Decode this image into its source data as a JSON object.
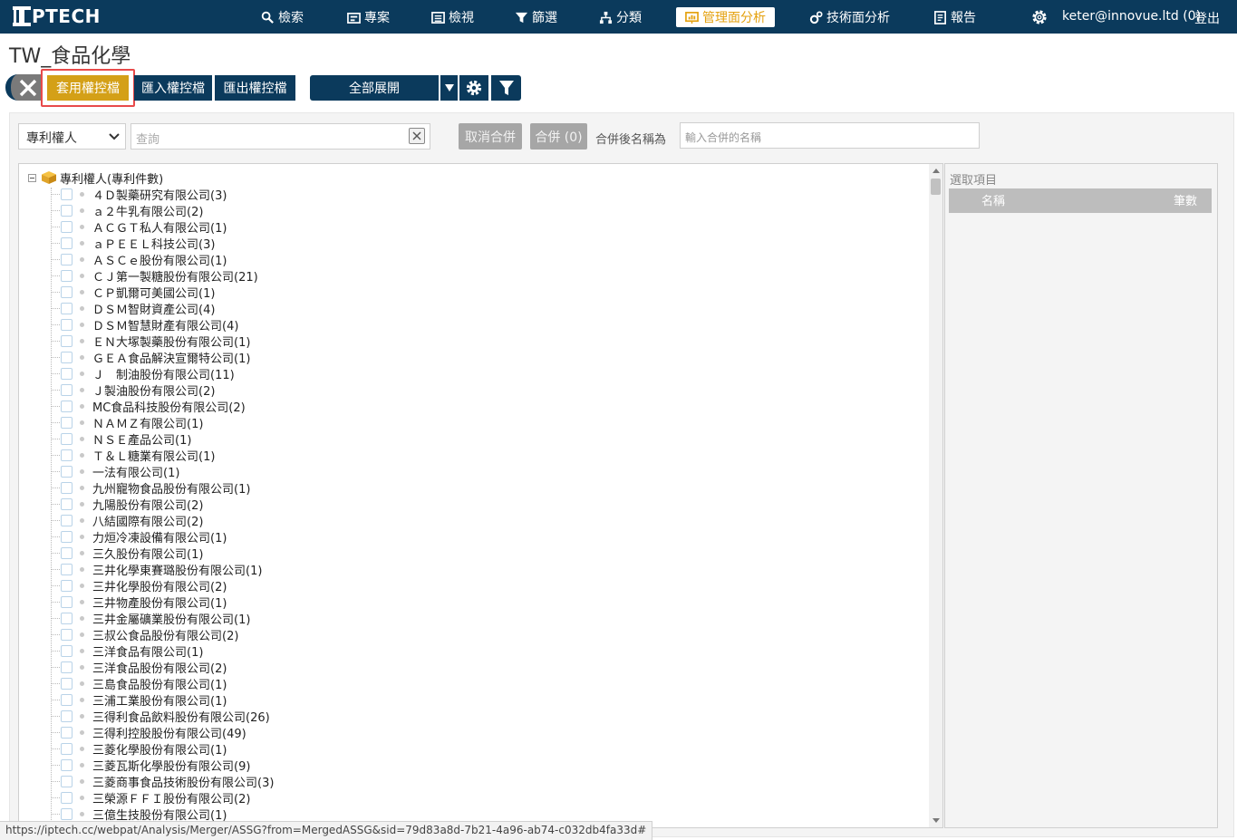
{
  "app": {
    "logo_text": "PTECH"
  },
  "nav": {
    "search": "檢索",
    "project": "專案",
    "review": "檢視",
    "filter": "篩選",
    "classify": "分類",
    "management": "管理面分析",
    "technical": "技術面分析",
    "report": "報告",
    "user": "keter@innovue.ltd (0)",
    "logout": "登出"
  },
  "page": {
    "title": "TW_食品化學"
  },
  "toolbar": {
    "apply": "套用權控檔",
    "import": "匯入權控檔",
    "export": "匯出權控檔",
    "expand_all": "全部展開"
  },
  "filters": {
    "field_select": "專利權人",
    "search_placeholder": "查詢",
    "unmerge": "取消合併",
    "merge": "合併 (0)",
    "merge_as_label": "合併後名稱為",
    "merge_name_placeholder": "輸入合併的名稱"
  },
  "tree": {
    "root": "專利權人(專利件數)",
    "items": [
      "４Ｄ製藥研究有限公司(3)",
      "ａ２牛乳有限公司(2)",
      "ＡＣＧＴ私人有限公司(1)",
      "ａＰＥＥＬ科技公司(3)",
      "ＡＳＣｅ股份有限公司(1)",
      "ＣＪ第一製糖股份有限公司(21)",
      "ＣＰ凱爾可美國公司(1)",
      "ＤＳＭ智財資產公司(4)",
      "ＤＳＭ智慧財產有限公司(4)",
      "ＥＮ大塚製藥股份有限公司(1)",
      "ＧＥＡ食品解決宣爾特公司(1)",
      "Ｊ　制油股份有限公司(11)",
      "Ｊ製油股份有限公司(2)",
      "MC食品科技股份有限公司(2)",
      "ＮＡＭＺ有限公司(1)",
      "ＮＳＥ產品公司(1)",
      "Ｔ＆Ｌ糖業有限公司(1)",
      "一法有限公司(1)",
      "九州寵物食品股份有限公司(1)",
      "九陽股份有限公司(2)",
      "八結國際有限公司(2)",
      "力烜冷凍設備有限公司(1)",
      "三久股份有限公司(1)",
      "三井化學東賽璐股份有限公司(1)",
      "三井化學股份有限公司(2)",
      "三井物產股份有限公司(1)",
      "三井金屬礦業股份有限公司(1)",
      "三叔公食品股份有限公司(2)",
      "三洋食品有限公司(1)",
      "三洋食品股份有限公司(2)",
      "三島食品股份有限公司(1)",
      "三浦工業股份有限公司(1)",
      "三得利食品飲料股份有限公司(26)",
      "三得利控股股份有限公司(49)",
      "三菱化學股份有限公司(1)",
      "三菱瓦斯化學股份有限公司(9)",
      "三菱商事食品技術股份有限公司(3)",
      "三榮源ＦＦＩ股份有限公司(2)",
      "三億生技股份有限公司(1)"
    ]
  },
  "selected": {
    "title": "選取項目",
    "col_name": "名稱",
    "col_count": "筆數"
  },
  "status": {
    "url": "https://iptech.cc/webpat/Analysis/Merger/ASSG?from=MergedASSG&sid=79d83a8d-7b21-4a96-ab74-c032db4fa33d#"
  },
  "colors": {
    "navbar": "#0b3a5c",
    "accent": "#d4a017",
    "highlight": "#e84a4a"
  }
}
